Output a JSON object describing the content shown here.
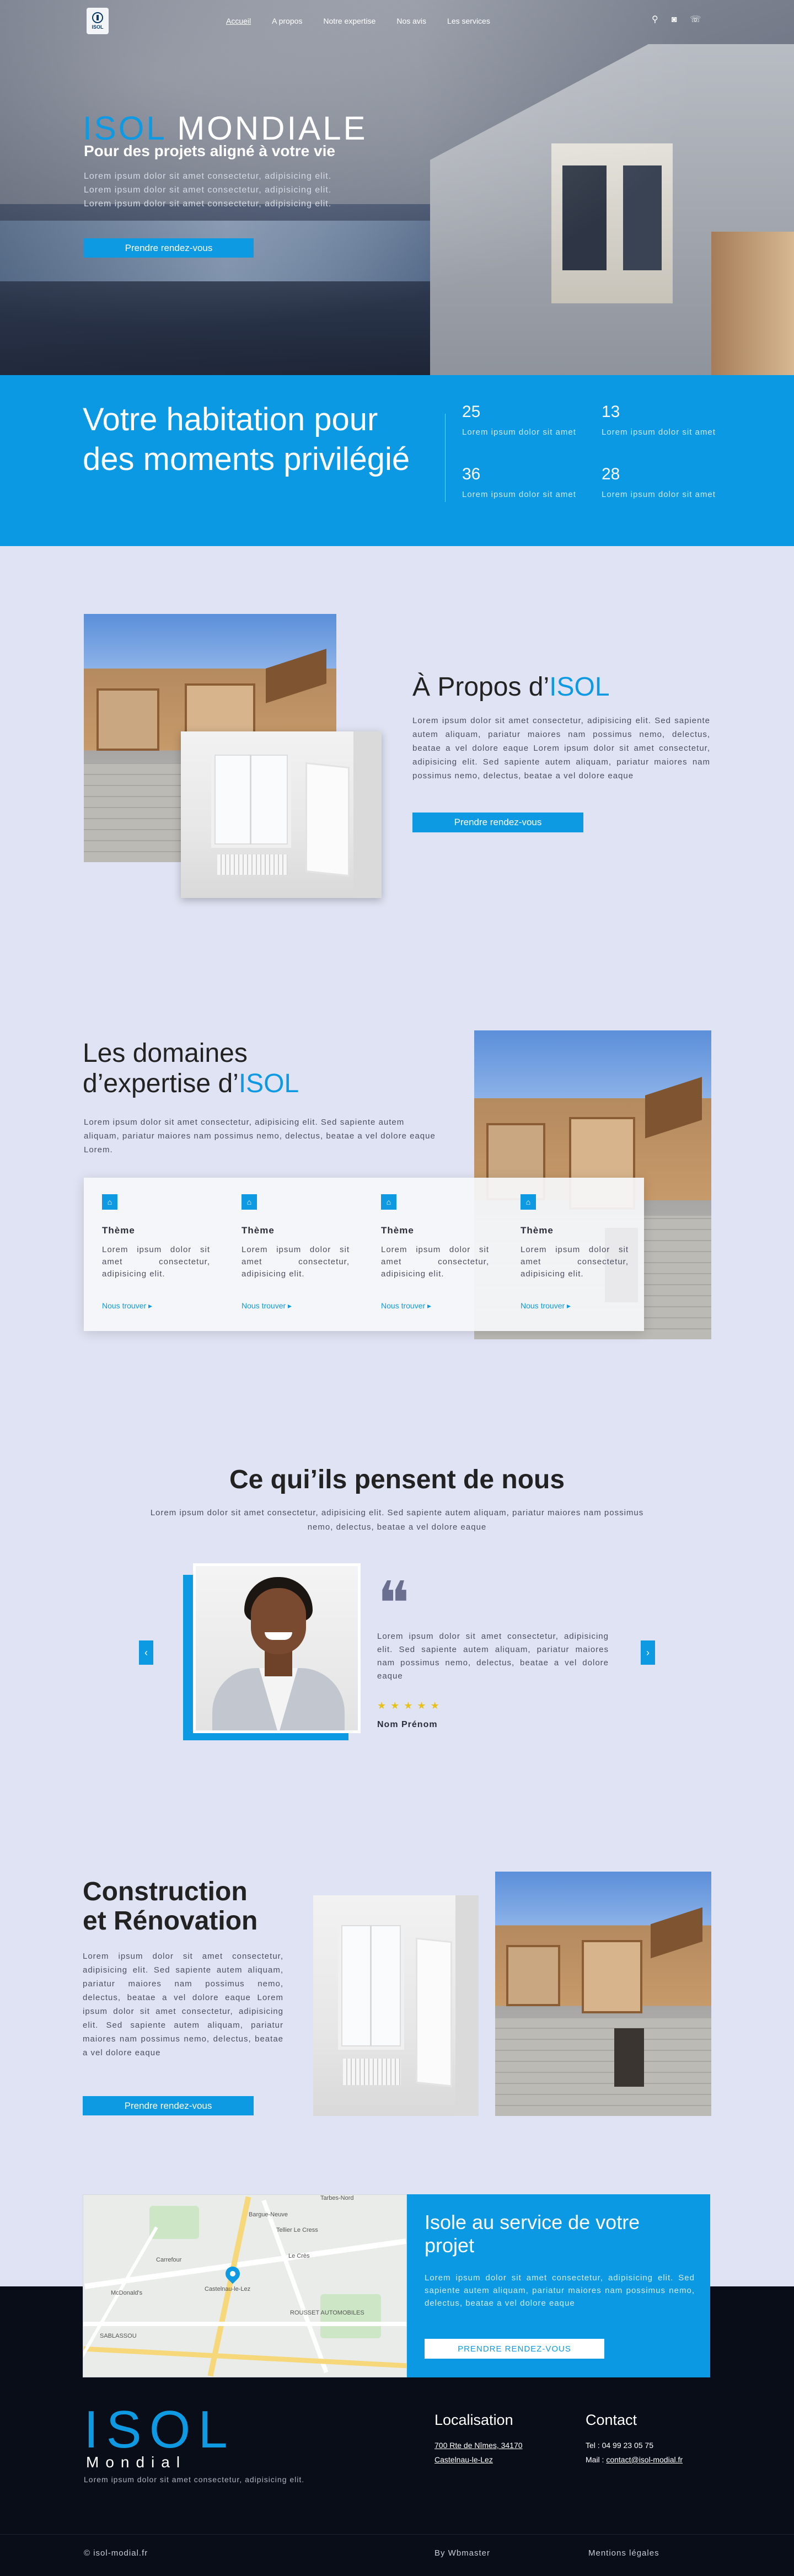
{
  "nav": {
    "items": [
      "Accueil",
      "A propos",
      "Notre expertise",
      "Nos avis",
      "Les services"
    ],
    "active": "Accueil",
    "logo_text": "ISOL",
    "social_icons": [
      "location-pin-icon",
      "instagram-icon",
      "phone-icon"
    ]
  },
  "hero": {
    "title_accent": "ISOL",
    "title_rest": "MONDIALE",
    "subtitle": "Pour des projets aligné à votre vie",
    "text": "Lorem ipsum dolor sit amet consectetur, adipisicing elit. Lorem ipsum dolor sit amet consectetur, adipisicing elit. Lorem ipsum dolor sit amet consectetur, adipisicing elit.",
    "button": "Prendre rendez-vous"
  },
  "band": {
    "heading": "Votre habitation pour des moments privilégié",
    "stats": [
      {
        "number": "25",
        "text": "Lorem ipsum dolor sit amet"
      },
      {
        "number": "13",
        "text": "Lorem ipsum dolor sit amet"
      },
      {
        "number": "36",
        "text": "Lorem ipsum dolor sit amet"
      },
      {
        "number": "28",
        "text": "Lorem ipsum dolor sit amet"
      }
    ]
  },
  "about": {
    "heading_prefix": "À Propos d’",
    "heading_accent": "ISOL",
    "text": "Lorem ipsum dolor sit amet consectetur, adipisicing elit. Sed sapiente autem aliquam, pariatur maiores nam possimus nemo, delectus, beatae a vel dolore eaque Lorem ipsum dolor sit amet consectetur, adipisicing elit. Sed sapiente autem aliquam, pariatur maiores nam possimus nemo, delectus, beatae a vel dolore eaque",
    "button": "Prendre rendez-vous"
  },
  "domains": {
    "heading_line1": "Les domaines",
    "heading_line2_prefix": "d’expertise d’",
    "heading_accent": "ISOL",
    "text": "Lorem ipsum dolor sit amet consectetur, adipisicing elit. Sed sapiente autem aliquam, pariatur maiores nam possimus nemo, delectus, beatae a vel dolore eaque Lorem.",
    "cards": [
      {
        "icon": "home-icon",
        "title": "Thème",
        "text": "Lorem ipsum dolor sit amet consectetur, adipisicing elit.",
        "link": "Nous trouver"
      },
      {
        "icon": "home-icon",
        "title": "Thème",
        "text": "Lorem ipsum dolor sit amet consectetur, adipisicing elit.",
        "link": "Nous trouver"
      },
      {
        "icon": "home-icon",
        "title": "Thème",
        "text": "Lorem ipsum dolor sit amet consectetur, adipisicing elit.",
        "link": "Nous trouver"
      },
      {
        "icon": "home-icon",
        "title": "Thème",
        "text": "Lorem ipsum dolor sit amet consectetur, adipisicing elit.",
        "link": "Nous trouver"
      }
    ]
  },
  "testimonials": {
    "heading": "Ce qui’ils pensent de nous",
    "text": "Lorem ipsum dolor sit amet consectetur, adipisicing elit. Sed sapiente autem aliquam, pariatur maiores nam possimus nemo, delectus, beatae a vel dolore eaque",
    "quote": "Lorem ipsum dolor sit amet consectetur, adipisicing elit. Sed sapiente autem aliquam, pariatur maiores nam possimus nemo, delectus, beatae a vel dolore eaque",
    "rating": 5,
    "name": "Nom Prénom",
    "prev": "‹",
    "next": "›"
  },
  "construction": {
    "heading_line1": "Construction",
    "heading_line2": "et Rénovation",
    "text": "Lorem ipsum dolor sit amet consectetur, adipisicing elit. Sed sapiente autem aliquam, pariatur maiores nam possimus nemo, delectus, beatae a vel dolore eaque Lorem ipsum dolor sit amet consectetur, adipisicing elit. Sed sapiente autem aliquam, pariatur maiores nam possimus nemo, delectus, beatae a vel dolore eaque",
    "button": "Prendre rendez-vous"
  },
  "map": {
    "labels": [
      "Bargue-Neuve",
      "Tarbes-Nord",
      "Le Crès",
      "Castelnau-le-Lez",
      "Carrefour",
      "McDonald's",
      "ROUSSET AUTOMOBILES",
      "SABLASSOU",
      "Tellier Le Cress"
    ]
  },
  "cta": {
    "heading": "Isole au service de votre projet",
    "text": "Lorem ipsum dolor sit amet consectetur, adipisicing elit. Sed sapiente autem aliquam, pariatur maiores nam possimus nemo, delectus, beatae a vel dolore eaque",
    "button": "PRENDRE RENDEZ-VOUS"
  },
  "footer": {
    "logo_big": "ISOL",
    "logo_small": "Mondial",
    "text": "Lorem ipsum dolor sit amet consectetur, adipisicing elit.",
    "loc_heading": "Localisation",
    "address1": "700 Rte de Nîmes, 34170",
    "address2": "Castelnau-le-Lez",
    "contact_heading": "Contact",
    "tel": "Tel : 04 99 23 05 75",
    "mail_label": "Mail : ",
    "mail": "contact@isol-modial.fr",
    "copyright": "© isol-modial.fr",
    "by": "By Wbmaster",
    "legal": "Mentions légales"
  },
  "colors": {
    "accent": "#0e9ae3",
    "background": "#e0e3f3",
    "footer": "#080d18",
    "star": "#e8c116"
  }
}
